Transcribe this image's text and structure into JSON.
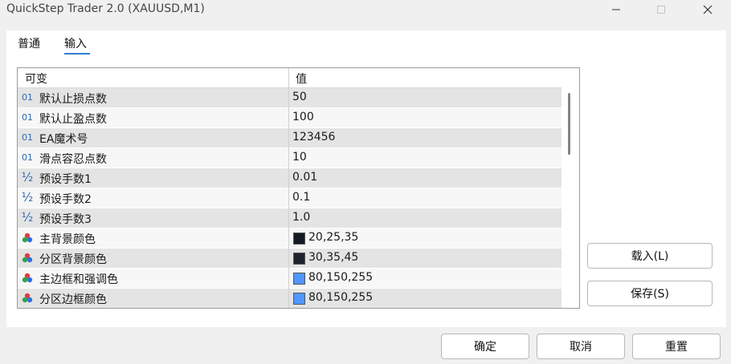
{
  "window": {
    "title": "QuickStep Trader 2.0 (XAUUSD,M1)"
  },
  "tabs": [
    {
      "label": "普通",
      "active": false
    },
    {
      "label": "输入",
      "active": true
    }
  ],
  "grid": {
    "columns": [
      "可变",
      "值"
    ],
    "rows": [
      {
        "icon": "integer-icon",
        "glyph": "01",
        "name": "默认止损点数",
        "value": "50"
      },
      {
        "icon": "integer-icon",
        "glyph": "01",
        "name": "默认止盈点数",
        "value": "100"
      },
      {
        "icon": "integer-icon",
        "glyph": "01",
        "name": "EA魔术号",
        "value": "123456"
      },
      {
        "icon": "integer-icon",
        "glyph": "01",
        "name": "滑点容忍点数",
        "value": "10"
      },
      {
        "icon": "fraction-icon",
        "glyph": "½",
        "name": "预设手数1",
        "value": "0.01"
      },
      {
        "icon": "fraction-icon",
        "glyph": "½",
        "name": "预设手数2",
        "value": "0.1"
      },
      {
        "icon": "fraction-icon",
        "glyph": "½",
        "name": "预设手数3",
        "value": "1.0"
      },
      {
        "icon": "color-icon",
        "glyph": "",
        "name": "主背景颜色",
        "value": "20,25,35",
        "swatch": "#141923"
      },
      {
        "icon": "color-icon",
        "glyph": "",
        "name": "分区背景颜色",
        "value": "30,35,45",
        "swatch": "#1e232d"
      },
      {
        "icon": "color-icon",
        "glyph": "",
        "name": "主边框和强调色",
        "value": "80,150,255",
        "swatch": "#5096ff"
      },
      {
        "icon": "color-icon",
        "glyph": "",
        "name": "分区边框颜色",
        "value": "80,150,255",
        "swatch": "#5096ff"
      }
    ]
  },
  "side_buttons": {
    "load": "载入(L)",
    "save": "保存(S)"
  },
  "footer_buttons": {
    "ok": "确定",
    "cancel": "取消",
    "reset": "重置"
  }
}
